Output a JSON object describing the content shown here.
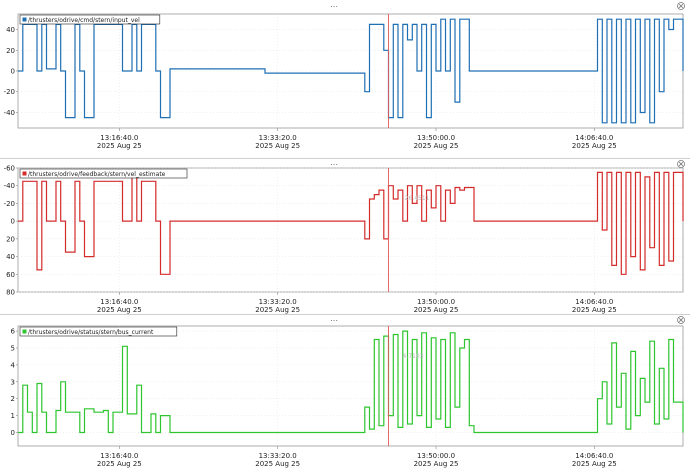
{
  "cursor_time": "13:45:00",
  "chart_data": [
    {
      "type": "line",
      "title": "",
      "legend_label": "/thrusters/odrive/cmd/stern/input_vel",
      "legend_placement": "top-left",
      "color": "#1f6fb5",
      "xlim": [
        "13:06:00",
        "14:16:00"
      ],
      "ylim": [
        -55,
        55
      ],
      "y_inverted": false,
      "yticks": [
        40,
        20,
        0,
        -20,
        -40
      ],
      "ytick_labels": [
        "40",
        "20",
        "0",
        "-20",
        "-40"
      ],
      "xticks": [
        "13:16:40",
        "13:33:20",
        "13:50:00",
        "14:06:40"
      ],
      "xtick_labels": [
        "13:16:40.0",
        "13:33:20.0",
        "13:50:00.0",
        "14:06:40.0"
      ],
      "xtick_sublabels": [
        "2025 Aug 25",
        "2025 Aug 25",
        "2025 Aug 25",
        "2025 Aug 25"
      ],
      "grid": true,
      "cursor_label": "",
      "x": [
        "13:06:00",
        "13:06:30",
        "13:07:00",
        "13:08:00",
        "13:08:30",
        "13:09:00",
        "13:10:00",
        "13:10:30",
        "13:11:00",
        "13:12:00",
        "13:12:30",
        "13:13:00",
        "13:14:00",
        "13:15:00",
        "13:16:00",
        "13:17:00",
        "13:18:00",
        "13:18:30",
        "13:19:00",
        "13:20:00",
        "13:20:30",
        "13:21:00",
        "13:22:00",
        "13:24:00",
        "13:26:00",
        "13:28:00",
        "13:30:00",
        "13:30:30",
        "13:32:00",
        "13:36:00",
        "13:40:00",
        "13:42:00",
        "13:42:30",
        "13:43:00",
        "13:43:30",
        "13:44:00",
        "13:44:30",
        "13:45:00",
        "13:45:30",
        "13:46:00",
        "13:46:30",
        "13:47:00",
        "13:47:30",
        "13:48:00",
        "13:48:30",
        "13:49:00",
        "13:49:30",
        "13:50:00",
        "13:50:30",
        "13:51:00",
        "13:51:30",
        "13:52:00",
        "13:52:30",
        "13:53:00",
        "13:53:30",
        "13:54:00",
        "13:55:00",
        "13:56:00",
        "13:57:00",
        "13:58:00",
        "13:59:00",
        "14:00:00",
        "14:01:00",
        "14:02:00",
        "14:03:00",
        "14:04:00",
        "14:05:00",
        "14:06:00",
        "14:07:00",
        "14:07:30",
        "14:08:00",
        "14:08:30",
        "14:09:00",
        "14:09:30",
        "14:10:00",
        "14:10:30",
        "14:11:00",
        "14:11:30",
        "14:12:00",
        "14:12:30",
        "14:13:00",
        "14:13:30",
        "14:14:00",
        "14:14:30",
        "14:15:00",
        "14:16:00"
      ],
      "y": [
        0,
        45,
        45,
        0,
        45,
        2,
        45,
        0,
        -45,
        45,
        0,
        -45,
        45,
        45,
        45,
        0,
        45,
        0,
        45,
        45,
        0,
        -45,
        2,
        2,
        2,
        2,
        2,
        2,
        -2,
        -2,
        -2,
        -2,
        -20,
        45,
        45,
        45,
        20,
        -45,
        45,
        -45,
        45,
        30,
        45,
        0,
        45,
        -45,
        45,
        0,
        50,
        0,
        50,
        -30,
        50,
        50,
        0,
        0,
        0,
        0,
        0,
        0,
        0,
        0,
        0,
        0,
        0,
        0,
        0,
        0,
        50,
        -50,
        50,
        -50,
        50,
        -50,
        50,
        -50,
        50,
        -40,
        50,
        -50,
        50,
        -20,
        50,
        40,
        50,
        0
      ]
    },
    {
      "type": "line",
      "title": "",
      "legend_label": "/thrusters/odrive/feedback/stern/vel_estimate",
      "legend_placement": "top-left",
      "color": "#d42b2b",
      "xlim": [
        "13:06:00",
        "14:16:00"
      ],
      "ylim": [
        -60,
        80
      ],
      "y_inverted": true,
      "yticks": [
        -60,
        -40,
        -20,
        0,
        20,
        40,
        60,
        80
      ],
      "ytick_labels": [
        "-60",
        "-40",
        "-20",
        "0",
        "20",
        "40",
        "60",
        "80"
      ],
      "xticks": [
        "13:16:40",
        "13:33:20",
        "13:50:00",
        "14:06:40"
      ],
      "xtick_labels": [
        "13:16:40.0",
        "13:33:20.0",
        "13:50:00.0",
        "14:06:40.0"
      ],
      "xtick_sublabels": [
        "2025 Aug 25",
        "2025 Aug 25",
        "2025 Aug 25",
        "2025 Aug 25"
      ],
      "grid": true,
      "cursor_label": "-26.4511",
      "x": [
        "13:06:00",
        "13:06:30",
        "13:07:00",
        "13:08:00",
        "13:08:30",
        "13:09:00",
        "13:10:00",
        "13:10:30",
        "13:11:00",
        "13:12:00",
        "13:12:30",
        "13:13:00",
        "13:14:00",
        "13:15:00",
        "13:16:00",
        "13:17:00",
        "13:18:00",
        "13:18:30",
        "13:19:00",
        "13:20:00",
        "13:20:30",
        "13:21:00",
        "13:22:00",
        "13:24:00",
        "13:26:00",
        "13:28:00",
        "13:30:00",
        "13:32:00",
        "13:36:00",
        "13:40:00",
        "13:42:00",
        "13:42:30",
        "13:43:00",
        "13:43:30",
        "13:44:00",
        "13:44:30",
        "13:45:00",
        "13:45:30",
        "13:46:00",
        "13:46:30",
        "13:47:00",
        "13:47:30",
        "13:48:00",
        "13:48:30",
        "13:49:00",
        "13:49:30",
        "13:50:00",
        "13:50:30",
        "13:51:00",
        "13:51:30",
        "13:52:00",
        "13:52:30",
        "13:53:00",
        "13:53:30",
        "13:54:00",
        "13:55:00",
        "13:56:00",
        "13:57:00",
        "13:58:00",
        "13:59:00",
        "14:00:00",
        "14:01:00",
        "14:02:00",
        "14:03:00",
        "14:04:00",
        "14:05:00",
        "14:06:00",
        "14:07:00",
        "14:07:30",
        "14:08:00",
        "14:08:30",
        "14:09:00",
        "14:09:30",
        "14:10:00",
        "14:10:30",
        "14:11:00",
        "14:11:30",
        "14:12:00",
        "14:12:30",
        "14:13:00",
        "14:13:30",
        "14:14:00",
        "14:14:30",
        "14:15:00",
        "14:16:00"
      ],
      "y": [
        0,
        -45,
        -45,
        55,
        -45,
        0,
        -45,
        0,
        35,
        -45,
        0,
        40,
        -45,
        -45,
        -45,
        0,
        -50,
        0,
        -45,
        -45,
        0,
        60,
        0,
        0,
        0,
        0,
        0,
        0,
        0,
        0,
        0,
        20,
        -25,
        -30,
        -35,
        20,
        -40,
        -25,
        -35,
        0,
        -40,
        -20,
        -40,
        0,
        -35,
        -15,
        -40,
        0,
        -35,
        -20,
        -38,
        -35,
        -38,
        -38,
        0,
        0,
        0,
        0,
        0,
        0,
        0,
        0,
        0,
        0,
        0,
        0,
        0,
        -55,
        10,
        -55,
        50,
        -55,
        60,
        -55,
        40,
        -55,
        55,
        -50,
        30,
        -55,
        50,
        -55,
        45,
        -55,
        0
      ]
    },
    {
      "type": "line",
      "title": "",
      "legend_label": "/thrusters/odrive/status/stern/bus_current",
      "legend_placement": "top-left",
      "color": "#2ec52e",
      "xlim": [
        "13:06:00",
        "14:16:00"
      ],
      "ylim": [
        -0.8,
        6.3
      ],
      "y_inverted": false,
      "yticks": [
        6,
        5,
        4,
        3,
        2,
        1,
        0
      ],
      "ytick_labels": [
        "6",
        "5",
        "4",
        "3",
        "2",
        "1",
        "0"
      ],
      "xticks": [
        "13:16:40",
        "13:33:20",
        "13:50:00",
        "14:06:40"
      ],
      "xtick_labels": [
        "13:16:40.0",
        "13:33:20.0",
        "13:50:00.0",
        "14:06:40.0"
      ],
      "xtick_sublabels": [
        "2025 Aug 25",
        "2025 Aug 25",
        "2025 Aug 25",
        "2025 Aug 25"
      ],
      "grid": true,
      "cursor_label": "4.7103",
      "x": [
        "13:06:00",
        "13:06:30",
        "13:07:00",
        "13:07:30",
        "13:08:00",
        "13:08:30",
        "13:09:00",
        "13:10:00",
        "13:10:30",
        "13:11:00",
        "13:12:00",
        "13:12:30",
        "13:13:00",
        "13:14:00",
        "13:15:00",
        "13:15:30",
        "13:16:00",
        "13:17:00",
        "13:17:30",
        "13:18:00",
        "13:18:30",
        "13:19:00",
        "13:20:00",
        "13:20:30",
        "13:21:00",
        "13:22:00",
        "13:24:00",
        "13:30:00",
        "13:36:00",
        "13:40:00",
        "13:42:00",
        "13:42:30",
        "13:43:00",
        "13:43:30",
        "13:44:00",
        "13:44:30",
        "13:45:00",
        "13:45:30",
        "13:46:00",
        "13:46:30",
        "13:47:00",
        "13:47:30",
        "13:48:00",
        "13:48:30",
        "13:49:00",
        "13:49:30",
        "13:50:00",
        "13:50:30",
        "13:51:00",
        "13:51:30",
        "13:52:00",
        "13:52:30",
        "13:53:00",
        "13:53:30",
        "13:54:00",
        "13:55:00",
        "13:56:00",
        "13:58:00",
        "14:00:00",
        "14:02:00",
        "14:04:00",
        "14:05:00",
        "14:06:00",
        "14:07:00",
        "14:07:30",
        "14:08:00",
        "14:08:30",
        "14:09:00",
        "14:09:30",
        "14:10:00",
        "14:10:30",
        "14:11:00",
        "14:11:30",
        "14:12:00",
        "14:12:30",
        "14:13:00",
        "14:13:30",
        "14:14:00",
        "14:14:30",
        "14:15:00",
        "14:16:00"
      ],
      "y": [
        0,
        2.8,
        1.2,
        0,
        2.9,
        1.2,
        0,
        1.3,
        3,
        1.2,
        1.2,
        0,
        1.4,
        1.2,
        1.3,
        0,
        1.2,
        5.1,
        1.1,
        1.1,
        2.8,
        0,
        1.1,
        0,
        1.0,
        0,
        0,
        0,
        0,
        0,
        0,
        1.5,
        0.2,
        5.5,
        0.4,
        5.7,
        1.0,
        5.8,
        0.3,
        6.0,
        0.5,
        5.5,
        1.0,
        5.9,
        0.3,
        5.6,
        0.8,
        5.5,
        0.3,
        5.9,
        1.5,
        5.0,
        5.5,
        0.4,
        0,
        0,
        0,
        0,
        0,
        0,
        0,
        0,
        0,
        2.0,
        3.0,
        0.5,
        5.3,
        1.5,
        3.5,
        0.2,
        4.8,
        1.0,
        3.2,
        1.8,
        5.4,
        0.5,
        3.8,
        0.8,
        5.5,
        1.8,
        0
      ]
    }
  ]
}
